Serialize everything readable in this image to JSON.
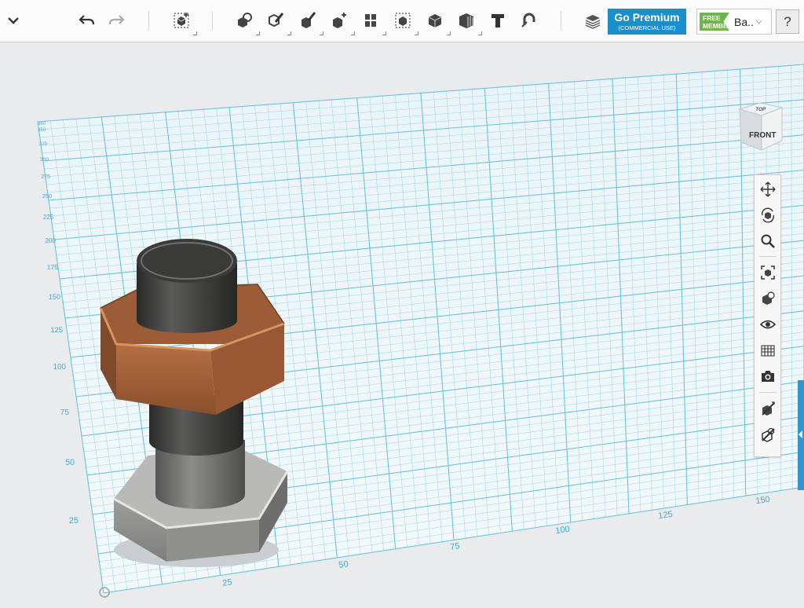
{
  "toolbar": {
    "menu_icon": "chevron-down-icon",
    "undo_icon": "undo-icon",
    "redo_icon": "redo-icon",
    "tools": [
      "primitives-icon",
      "sketch-icon",
      "construct-icon",
      "modify-icon",
      "pattern-icon",
      "grouping-icon",
      "combine-icon",
      "measure-icon",
      "text-icon",
      "snap-icon"
    ],
    "material_icon": "material-icon",
    "premium": {
      "title": "Go Premium",
      "subtitle": "(COMMERCIAL USE)",
      "color": "#1a8fc9"
    },
    "member": {
      "badge_line1": "FREE",
      "badge_line2": "MEMBER",
      "name": "Ba..",
      "badge_color": "#6fb64a"
    },
    "help_label": "?"
  },
  "viewcube": {
    "top_label": "TOP",
    "front_label": "FRONT"
  },
  "nav_panel": {
    "icons": [
      "pan-icon",
      "orbit-icon",
      "zoom-icon",
      "fit-icon",
      "view-mode-icon",
      "visibility-icon",
      "grid-icon",
      "camera-icon",
      "hide-icon",
      "materials-icon"
    ]
  },
  "grid": {
    "color": "#65c1e0",
    "left_axis_labels": [
      "25",
      "50",
      "75",
      "100",
      "125",
      "150",
      "175",
      "200",
      "225",
      "250",
      "275",
      "300",
      "325",
      "350",
      "360"
    ],
    "bottom_axis_labels": [
      "25",
      "50",
      "75",
      "100",
      "125",
      "150"
    ]
  },
  "colors": {
    "nut": "#a0603a",
    "bolt": "#4a4b49",
    "base": "#a7a8a6",
    "accent": "#2f97d1"
  }
}
